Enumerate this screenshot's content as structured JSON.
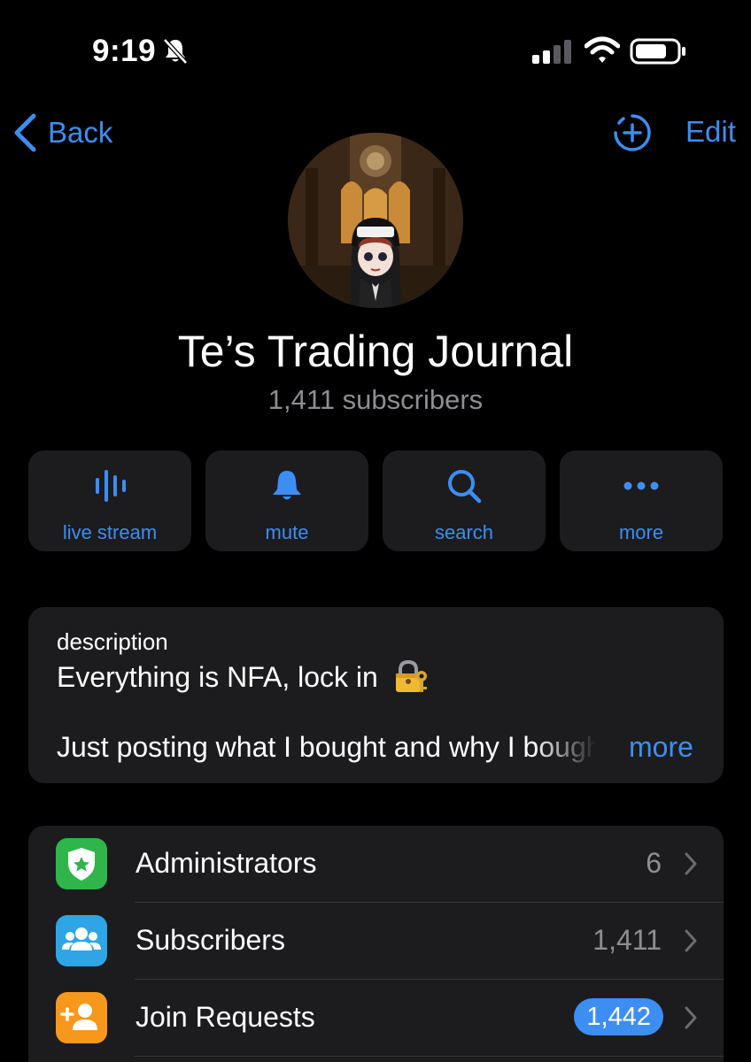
{
  "status_bar": {
    "time": "9:19",
    "icons": [
      "bell-slash-icon",
      "cellular-signal-icon",
      "wifi-icon",
      "battery-icon"
    ]
  },
  "nav": {
    "back_label": "Back",
    "edit_label": "Edit",
    "add_icon": "add-story-icon"
  },
  "channel": {
    "title": "Te’s Trading Journal",
    "subtitle": "1,411 subscribers"
  },
  "actions": [
    {
      "label": "live stream",
      "icon": "waveform-icon"
    },
    {
      "label": "mute",
      "icon": "bell-icon"
    },
    {
      "label": "search",
      "icon": "magnifier-icon"
    },
    {
      "label": "more",
      "icon": "ellipsis-icon"
    }
  ],
  "description": {
    "label": "description",
    "line1": "Everything is NFA, lock in",
    "line1_emoji": "lock-with-key-icon",
    "line2": "Just posting what I bought and why I bought",
    "more_label": "more"
  },
  "settings": [
    {
      "label": "Administrators",
      "value": "6",
      "icon": "shield-star-icon",
      "icon_color": "#2fb54a"
    },
    {
      "label": "Subscribers",
      "value": "1,411",
      "icon": "people-icon",
      "icon_color": "#2ea6e6"
    },
    {
      "label": "Join Requests",
      "badge": "1,442",
      "icon": "person-add-icon",
      "icon_color": "#f7981d"
    }
  ],
  "colors": {
    "background": "#000000",
    "card": "#1c1c1e",
    "accent": "#3d8ef3",
    "secondary_text": "#8e8e93"
  }
}
